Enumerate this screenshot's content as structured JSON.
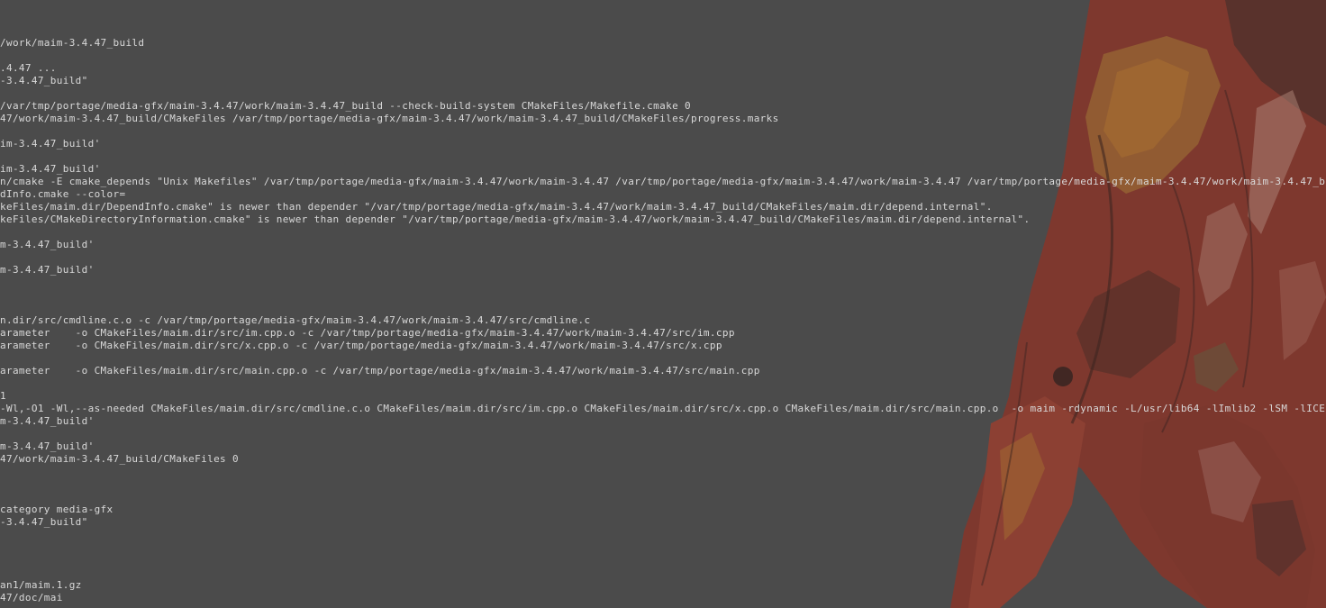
{
  "terminal": {
    "lines": [
      "/work/maim-3.4.47_build",
      "",
      ".4.47 ...",
      "-3.4.47_build\"",
      "",
      "/var/tmp/portage/media-gfx/maim-3.4.47/work/maim-3.4.47_build --check-build-system CMakeFiles/Makefile.cmake 0",
      "47/work/maim-3.4.47_build/CMakeFiles /var/tmp/portage/media-gfx/maim-3.4.47/work/maim-3.4.47_build/CMakeFiles/progress.marks",
      "",
      "im-3.4.47_build'",
      "",
      "im-3.4.47_build'",
      "n/cmake -E cmake_depends \"Unix Makefiles\" /var/tmp/portage/media-gfx/maim-3.4.47/work/maim-3.4.47 /var/tmp/portage/media-gfx/maim-3.4.47/work/maim-3.4.47 /var/tmp/portage/media-gfx/maim-3.4.47/work/maim-3.4.47_b",
      "dInfo.cmake --color=",
      "keFiles/maim.dir/DependInfo.cmake\" is newer than depender \"/var/tmp/portage/media-gfx/maim-3.4.47/work/maim-3.4.47_build/CMakeFiles/maim.dir/depend.internal\".",
      "keFiles/CMakeDirectoryInformation.cmake\" is newer than depender \"/var/tmp/portage/media-gfx/maim-3.4.47/work/maim-3.4.47_build/CMakeFiles/maim.dir/depend.internal\".",
      "",
      "m-3.4.47_build'",
      "",
      "m-3.4.47_build'",
      "",
      "",
      "",
      "n.dir/src/cmdline.c.o -c /var/tmp/portage/media-gfx/maim-3.4.47/work/maim-3.4.47/src/cmdline.c",
      "arameter    -o CMakeFiles/maim.dir/src/im.cpp.o -c /var/tmp/portage/media-gfx/maim-3.4.47/work/maim-3.4.47/src/im.cpp",
      "arameter    -o CMakeFiles/maim.dir/src/x.cpp.o -c /var/tmp/portage/media-gfx/maim-3.4.47/work/maim-3.4.47/src/x.cpp",
      "",
      "arameter    -o CMakeFiles/maim.dir/src/main.cpp.o -c /var/tmp/portage/media-gfx/maim-3.4.47/work/maim-3.4.47/src/main.cpp",
      "",
      "1",
      "-Wl,-O1 -Wl,--as-needed CMakeFiles/maim.dir/src/cmdline.c.o CMakeFiles/maim.dir/src/im.cpp.o CMakeFiles/maim.dir/src/x.cpp.o CMakeFiles/maim.dir/src/main.cpp.o  -o maim -rdynamic -L/usr/lib64 -lImlib2 -lSM -lICE",
      "m-3.4.47_build'",
      "",
      "m-3.4.47_build'",
      "47/work/maim-3.4.47_build/CMakeFiles 0",
      "",
      "",
      "",
      "category media-gfx",
      "-3.4.47_build\"",
      "",
      "",
      "",
      "",
      "an1/maim.1.gz",
      "47/doc/mai"
    ]
  },
  "wallpaper": {
    "subject": "robot-figure-artwork",
    "colors": {
      "background": "#4b4b4b",
      "armor_red": "#9c3b2c",
      "armor_dark": "#5e2a22",
      "armor_orange": "#c0752a",
      "highlight": "#c99080",
      "text": "#d9d9d9"
    }
  }
}
